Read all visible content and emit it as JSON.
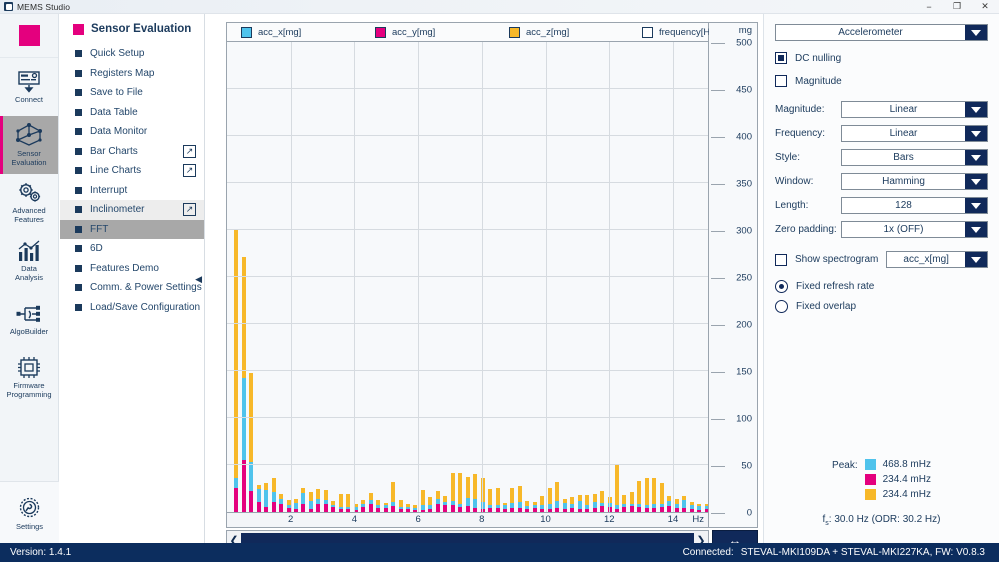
{
  "window": {
    "title": "MEMS Studio",
    "app_icon": "app-icon",
    "minimize": "−",
    "maximize": "❐",
    "close": "✕"
  },
  "rail": {
    "logo": "logo-square",
    "items": [
      {
        "label": "Connect",
        "icon": "connect-icon",
        "active": false
      },
      {
        "label": "Sensor\nEvaluation",
        "icon": "sensor-node-icon",
        "active": true
      },
      {
        "label": "Advanced\nFeatures",
        "icon": "gears-icon",
        "active": false
      },
      {
        "label": "Data\nAnalysis",
        "icon": "bar-chart-icon",
        "active": false
      },
      {
        "label": "AlgoBuilder",
        "icon": "node-graph-icon",
        "active": false
      },
      {
        "label": "Firmware\nProgramming",
        "icon": "chip-icon",
        "active": false
      }
    ],
    "settings": {
      "label": "Settings",
      "icon": "gear-icon"
    }
  },
  "menu": {
    "title": "Sensor Evaluation",
    "items": [
      {
        "label": "Quick Setup",
        "popout": false,
        "state": "normal"
      },
      {
        "label": "Registers Map",
        "popout": false,
        "state": "normal"
      },
      {
        "label": "Save to File",
        "popout": false,
        "state": "normal"
      },
      {
        "label": "Data Table",
        "popout": false,
        "state": "normal"
      },
      {
        "label": "Data Monitor",
        "popout": false,
        "state": "normal"
      },
      {
        "label": "Bar Charts",
        "popout": true,
        "state": "normal"
      },
      {
        "label": "Line Charts",
        "popout": true,
        "state": "normal"
      },
      {
        "label": "Interrupt",
        "popout": false,
        "state": "normal"
      },
      {
        "label": "Inclinometer",
        "popout": true,
        "state": "hover"
      },
      {
        "label": "FFT",
        "popout": false,
        "state": "selected"
      },
      {
        "label": "6D",
        "popout": false,
        "state": "normal"
      },
      {
        "label": "Features Demo",
        "popout": false,
        "state": "normal"
      },
      {
        "label": "Comm. & Power Settings",
        "popout": false,
        "state": "normal"
      },
      {
        "label": "Load/Save Configuration",
        "popout": false,
        "state": "normal"
      }
    ],
    "collapse": "◀"
  },
  "chart_data": {
    "type": "bar",
    "title": "",
    "subtype": "stacked-fft-spectrum",
    "xlabel": "Hz",
    "ylabel": "mg",
    "xlim": [
      0,
      15.1
    ],
    "ylim": [
      0,
      500
    ],
    "xticks": [
      2,
      4,
      6,
      8,
      10,
      12,
      14
    ],
    "yticks": [
      0,
      50,
      100,
      150,
      200,
      250,
      300,
      350,
      400,
      450,
      500
    ],
    "grid": true,
    "legend_position": "top",
    "legend": [
      {
        "name": "acc_x[mg]",
        "color": "#4fc3ec"
      },
      {
        "name": "acc_y[mg]",
        "color": "#e4007e"
      },
      {
        "name": "acc_z[mg]",
        "color": "#f7b829"
      },
      {
        "name": "frequency[Hz]",
        "color": "#ffffff"
      }
    ],
    "x": [
      0.234,
      0.469,
      0.703,
      0.938,
      1.172,
      1.406,
      1.641,
      1.875,
      2.109,
      2.344,
      2.578,
      2.813,
      3.047,
      3.281,
      3.516,
      3.75,
      3.984,
      4.219,
      4.453,
      4.688,
      4.922,
      5.156,
      5.391,
      5.625,
      5.859,
      6.094,
      6.328,
      6.563,
      6.797,
      7.031,
      7.266,
      7.5,
      7.734,
      7.969,
      8.203,
      8.438,
      8.672,
      8.906,
      9.141,
      9.375,
      9.609,
      9.844,
      10.078,
      10.313,
      10.547,
      10.781,
      11.016,
      11.25,
      11.484,
      11.719,
      11.953,
      12.188,
      12.422,
      12.656,
      12.891,
      13.125,
      13.359,
      13.594,
      13.828,
      14.063,
      14.297,
      14.531,
      14.766,
      15.0
    ],
    "series": [
      {
        "name": "acc_y[mg]",
        "color": "#e4007e",
        "values": [
          26,
          55,
          22,
          11,
          5,
          11,
          9,
          4,
          3,
          9,
          3,
          9,
          8,
          5,
          3,
          3,
          2,
          5,
          8,
          4,
          4,
          6,
          3,
          3,
          2,
          2,
          3,
          8,
          7,
          7,
          5,
          6,
          4,
          3,
          4,
          4,
          3,
          4,
          4,
          3,
          4,
          3,
          3,
          4,
          3,
          4,
          3,
          3,
          4,
          6,
          5,
          3,
          5,
          6,
          5,
          4,
          4,
          5,
          6,
          4,
          4,
          3,
          2,
          3
        ]
      },
      {
        "name": "acc_x[mg]",
        "color": "#4fc3ec",
        "values": [
          10,
          88,
          31,
          14,
          18,
          10,
          5,
          4,
          7,
          11,
          9,
          5,
          5,
          3,
          2,
          2,
          3,
          4,
          5,
          4,
          3,
          5,
          2,
          2,
          2,
          6,
          5,
          6,
          4,
          5,
          4,
          9,
          10,
          8,
          4,
          4,
          4,
          6,
          7,
          3,
          3,
          4,
          6,
          8,
          7,
          5,
          9,
          5,
          7,
          4,
          5,
          4,
          4,
          3,
          4,
          4,
          5,
          4,
          6,
          5,
          9,
          5,
          4,
          3
        ]
      },
      {
        "name": "acc_z[mg]",
        "color": "#f7b829",
        "values": [
          264,
          128,
          95,
          4,
          8,
          15,
          5,
          5,
          4,
          6,
          9,
          10,
          10,
          4,
          14,
          14,
          4,
          4,
          7,
          5,
          3,
          21,
          8,
          4,
          3,
          15,
          8,
          8,
          6,
          29,
          32,
          22,
          26,
          25,
          17,
          18,
          3,
          16,
          17,
          6,
          4,
          10,
          17,
          20,
          4,
          7,
          6,
          10,
          8,
          12,
          6,
          44,
          9,
          12,
          24,
          28,
          27,
          22,
          5,
          5,
          4,
          3,
          3,
          3
        ]
      }
    ]
  },
  "scroller": {
    "left_arrow": "❮",
    "right_arrow": "❯",
    "fit_label": "↔"
  },
  "controls": {
    "sensor_select": {
      "label": "Accelerometer"
    },
    "dc_nulling": {
      "label": "DC nulling",
      "checked": true
    },
    "magnitude_check": {
      "label": "Magnitude",
      "checked": false
    },
    "fields": [
      {
        "label": "Magnitude:",
        "value": "Linear"
      },
      {
        "label": "Frequency:",
        "value": "Linear"
      },
      {
        "label": "Style:",
        "value": "Bars"
      },
      {
        "label": "Window:",
        "value": "Hamming"
      },
      {
        "label": "Length:",
        "value": "128"
      },
      {
        "label": "Zero padding:",
        "value": "1x (OFF)"
      }
    ],
    "spectrogram": {
      "label": "Show spectrogram",
      "checked": false,
      "value": "acc_x[mg]"
    },
    "radios": [
      {
        "label": "Fixed refresh rate",
        "selected": true
      },
      {
        "label": "Fixed overlap",
        "selected": false
      }
    ],
    "peak": {
      "label": "Peak:",
      "rows": [
        {
          "color": "#4fc3ec",
          "value": "468.8 mHz"
        },
        {
          "color": "#e4007e",
          "value": "234.4 mHz"
        },
        {
          "color": "#f7b829",
          "value": "234.4 mHz"
        }
      ]
    },
    "fs_prefix": "f",
    "fs_sub": "s",
    "fs_text": ": 30.0 Hz (ODR: 30.2 Hz)"
  },
  "status": {
    "version": "Version: 1.4.1",
    "connected_label": "Connected:",
    "connected_value": "STEVAL-MKI109DA + STEVAL-MKI227KA, FW: V0.8.3"
  }
}
